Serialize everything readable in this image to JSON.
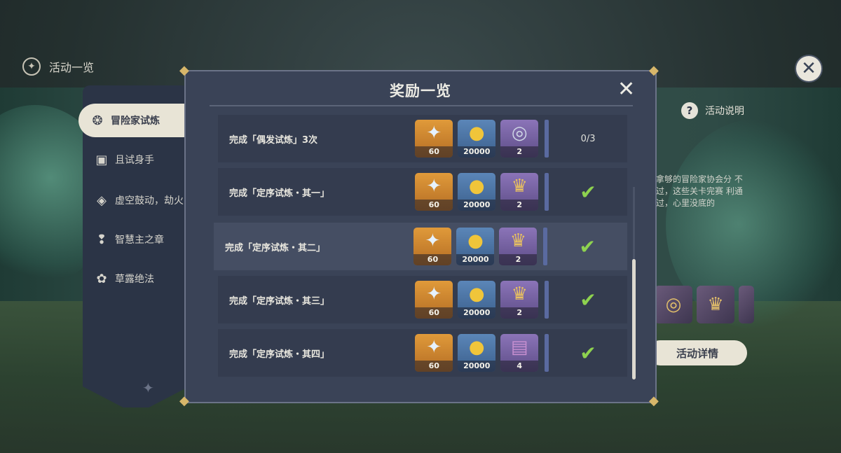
{
  "header": {
    "title": "活动一览",
    "close_icon": "close-icon"
  },
  "sidebar": {
    "items": [
      {
        "label": "冒险家试炼",
        "icon": "adventurer-icon",
        "active": true
      },
      {
        "label": "且试身手",
        "icon": "cards-icon",
        "active": false
      },
      {
        "label": "虚空鼓动，劫火",
        "icon": "diamond-icon",
        "active": false
      },
      {
        "label": "智慧主之章",
        "icon": "quill-icon",
        "active": false
      },
      {
        "label": "草露绝法",
        "icon": "gears-icon",
        "active": false
      }
    ]
  },
  "background_panel": {
    "help_label": "活动说明",
    "desc": "拿够的冒险家协会分 不过，这些关卡完赛 利通过，心里没底的",
    "detail_button": "活动详情"
  },
  "modal": {
    "title": "奖励一览",
    "rows": [
      {
        "label": "完成「偶发试炼」3次",
        "rewards": [
          {
            "icon": "primogem-icon",
            "count": "60",
            "bg": "gold"
          },
          {
            "icon": "mora-icon",
            "count": "20000",
            "bg": "blue"
          },
          {
            "icon": "ring-icon",
            "count": "2",
            "bg": "purple"
          }
        ],
        "status": "0/3",
        "completed": false,
        "highlight": false
      },
      {
        "label": "完成「定序试炼・其一」",
        "rewards": [
          {
            "icon": "primogem-icon",
            "count": "60",
            "bg": "gold"
          },
          {
            "icon": "mora-icon",
            "count": "20000",
            "bg": "blue"
          },
          {
            "icon": "crown-icon",
            "count": "2",
            "bg": "purple"
          }
        ],
        "status": "",
        "completed": true,
        "highlight": false
      },
      {
        "label": "完成「定序试炼・其二」",
        "rewards": [
          {
            "icon": "primogem-icon",
            "count": "60",
            "bg": "gold"
          },
          {
            "icon": "mora-icon",
            "count": "20000",
            "bg": "blue"
          },
          {
            "icon": "crown-icon",
            "count": "2",
            "bg": "purple"
          }
        ],
        "status": "",
        "completed": true,
        "highlight": true
      },
      {
        "label": "完成「定序试炼・其三」",
        "rewards": [
          {
            "icon": "primogem-icon",
            "count": "60",
            "bg": "gold"
          },
          {
            "icon": "mora-icon",
            "count": "20000",
            "bg": "blue"
          },
          {
            "icon": "crown-icon",
            "count": "2",
            "bg": "purple"
          }
        ],
        "status": "",
        "completed": true,
        "highlight": false
      },
      {
        "label": "完成「定序试炼・其四」",
        "rewards": [
          {
            "icon": "primogem-icon",
            "count": "60",
            "bg": "gold"
          },
          {
            "icon": "mora-icon",
            "count": "20000",
            "bg": "blue"
          },
          {
            "icon": "book-icon",
            "count": "4",
            "bg": "purple"
          }
        ],
        "status": "",
        "completed": true,
        "highlight": false
      }
    ]
  },
  "colors": {
    "check": "#8ed24f",
    "panel": "#3a4357",
    "accent_gold": "#d7b66a"
  }
}
